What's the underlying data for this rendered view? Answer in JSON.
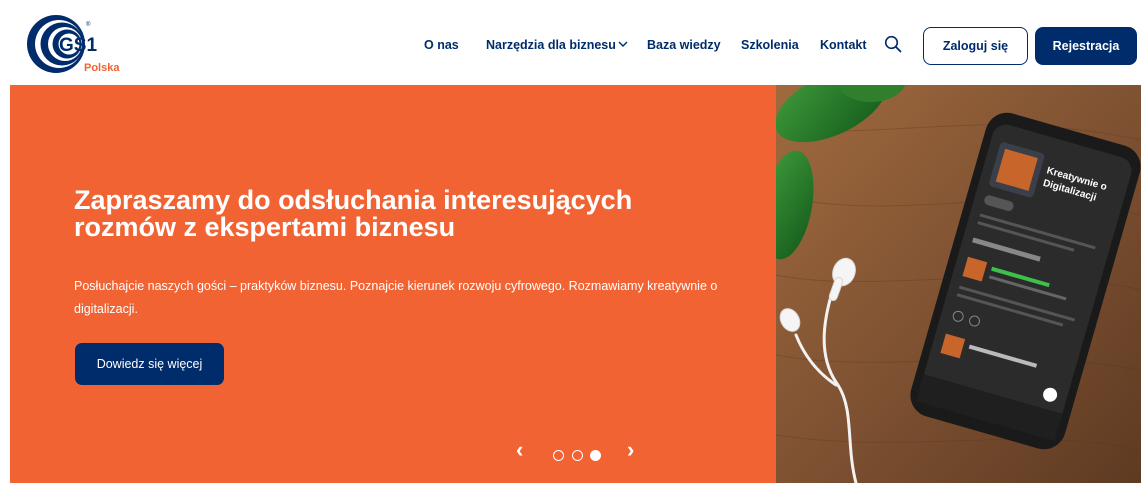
{
  "logo": {
    "mark": "GS1",
    "subtitle": "Polska"
  },
  "nav": {
    "items": [
      {
        "label": "O nas"
      },
      {
        "label": "Narzędzia dla biznesu"
      },
      {
        "label": "Baza wiedzy"
      },
      {
        "label": "Szkolenia"
      },
      {
        "label": "Kontakt"
      }
    ]
  },
  "header": {
    "login_label": "Zaloguj się",
    "register_label": "Rejestracja"
  },
  "hero": {
    "title": "Zapraszamy do odsłuchania interesujących rozmów z ekspertami biznesu",
    "text": "Posłuchajcie naszych gości – praktyków biznesu. Poznajcie kierunek rozwoju cyfrowego. Rozmawiamy kreatywnie o digitalizacji.",
    "cta_label": "Dowiedz się więcej",
    "prev_arrow": "‹",
    "next_arrow": "›",
    "slide_count": 3,
    "active_slide": 3
  },
  "phone": {
    "podcast_title": "Kreatywnie o Digitalizacji"
  },
  "colors": {
    "brand_navy": "#002c6c",
    "brand_orange": "#f26334",
    "wood": "#8a5a36"
  }
}
